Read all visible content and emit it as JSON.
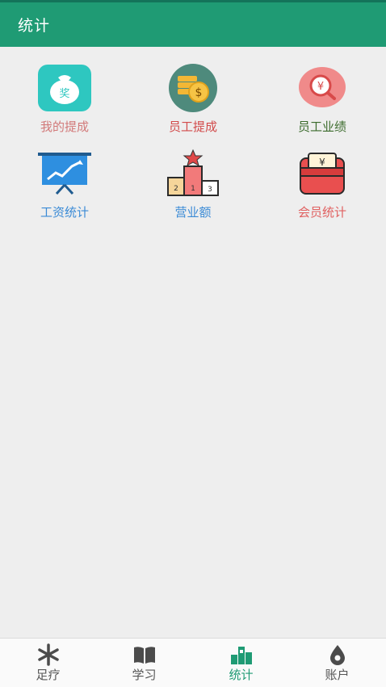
{
  "header": {
    "title": "统计"
  },
  "tiles": [
    {
      "label": "我的提成",
      "icon": "money-bag-icon",
      "color": "#d27a7a"
    },
    {
      "label": "员工提成",
      "icon": "coins-icon",
      "color": "#d24b4b"
    },
    {
      "label": "员工业绩",
      "icon": "search-yuan-icon",
      "color": "#3b6b2c"
    },
    {
      "label": "工资统计",
      "icon": "presentation-chart-icon",
      "color": "#3b8bd6"
    },
    {
      "label": "营业额",
      "icon": "podium-icon",
      "color": "#3b8bd6"
    },
    {
      "label": "会员统计",
      "icon": "wallet-icon",
      "color": "#e06060"
    }
  ],
  "tabs": [
    {
      "label": "足疗",
      "icon": "asterisk-icon",
      "active": false
    },
    {
      "label": "学习",
      "icon": "book-icon",
      "active": false
    },
    {
      "label": "统计",
      "icon": "stats-icon",
      "active": true
    },
    {
      "label": "账户",
      "icon": "drop-icon",
      "active": false
    }
  ],
  "colors": {
    "accent": "#1f9b74",
    "background": "#eeeeee"
  }
}
